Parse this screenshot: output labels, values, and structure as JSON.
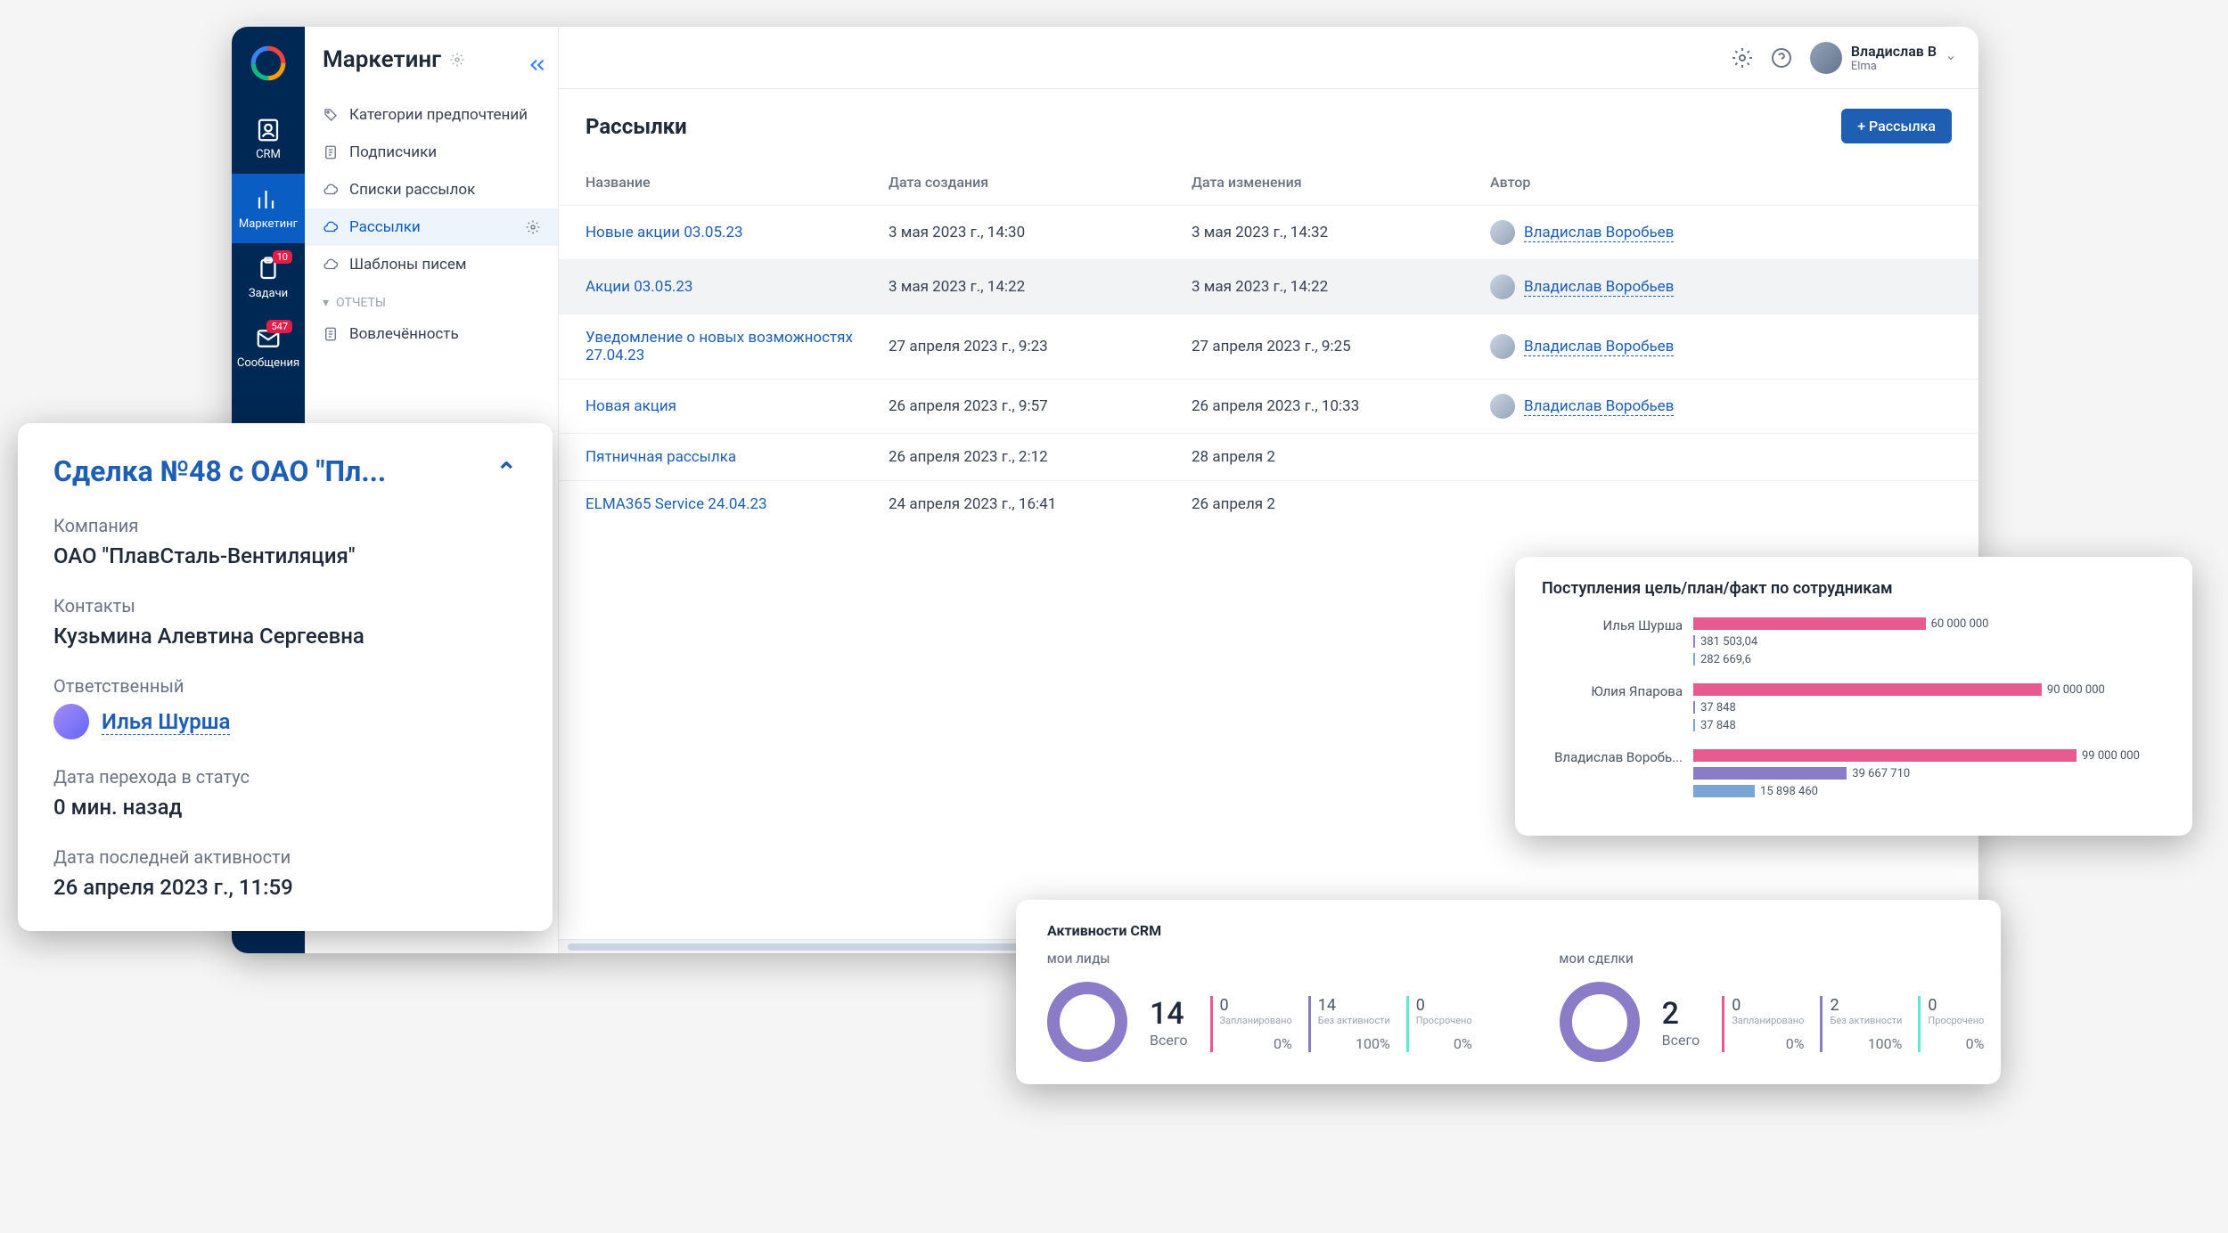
{
  "header": {
    "section_title": "Маркетинг",
    "user_name": "Владислав В",
    "user_org": "Elma"
  },
  "rail": [
    {
      "label": "CRM",
      "icon": "contact-icon",
      "active": false,
      "badge": null
    },
    {
      "label": "Маркетинг",
      "icon": "bars-icon",
      "active": true,
      "badge": null
    },
    {
      "label": "Задачи",
      "icon": "clipboard-icon",
      "active": false,
      "badge": "10"
    },
    {
      "label": "Сообщения",
      "icon": "mail-icon",
      "active": false,
      "badge": "547"
    }
  ],
  "sidebar": {
    "items": [
      {
        "label": "Категории предпочтений",
        "icon": "tag-icon",
        "active": false
      },
      {
        "label": "Подписчики",
        "icon": "doc-icon",
        "active": false
      },
      {
        "label": "Списки рассылок",
        "icon": "cloud-icon",
        "active": false
      },
      {
        "label": "Рассылки",
        "icon": "cloud-icon",
        "active": true
      },
      {
        "label": "Шаблоны писем",
        "icon": "cloud-icon",
        "active": false
      }
    ],
    "group_label": "ОТЧЕТЫ",
    "items2": [
      {
        "label": "Вовлечённость",
        "icon": "doc-icon",
        "active": false
      }
    ]
  },
  "page": {
    "title": "Рассылки",
    "add_button": "+ Рассылка"
  },
  "table": {
    "columns": [
      "Название",
      "Дата создания",
      "Дата изменения",
      "Автор"
    ],
    "rows": [
      {
        "name": "Новые акции 03.05.23",
        "created": "3 мая 2023 г., 14:30",
        "modified": "3 мая 2023 г., 14:32",
        "author": "Владислав Воробьев",
        "hover": false
      },
      {
        "name": "Акции 03.05.23",
        "created": "3 мая 2023 г., 14:22",
        "modified": "3 мая 2023 г., 14:22",
        "author": "Владислав Воробьев",
        "hover": true
      },
      {
        "name": "Уведомление о новых возможностях 27.04.23",
        "created": "27 апреля 2023 г., 9:23",
        "modified": "27 апреля 2023 г., 9:25",
        "author": "Владислав Воробьев",
        "hover": false
      },
      {
        "name": "Новая акция",
        "created": "26 апреля 2023 г., 9:57",
        "modified": "26 апреля 2023 г., 10:33",
        "author": "Владислав Воробьев",
        "hover": false
      },
      {
        "name": "Пятничная рассылка",
        "created": "26 апреля 2023 г., 2:12",
        "modified": "28 апреля 2",
        "author": "",
        "hover": false
      },
      {
        "name": "ELMA365 Service 24.04.23",
        "created": "24 апреля 2023 г., 16:41",
        "modified": "26 апреля 2",
        "author": "",
        "hover": false
      }
    ]
  },
  "deal": {
    "title": "Сделка №48 с ОАО \"Пл...",
    "fields": {
      "company_label": "Компания",
      "company_value": "ОАО \"ПлавСталь-Вентиляция\"",
      "contacts_label": "Контакты",
      "contacts_value": "Кузьмина Алевтина Сергеевна",
      "owner_label": "Ответственный",
      "owner_value": "Илья Шурша",
      "status_label": "Дата перехода в статус",
      "status_value": "0 мин. назад",
      "activity_label": "Дата последней активности",
      "activity_value": "26 апреля 2023 г., 11:59"
    }
  },
  "chart_data": {
    "type": "bar",
    "title": "Поступления цель/план/факт по сотрудникам",
    "orientation": "horizontal",
    "x_max": 99000000,
    "categories": [
      "Илья Шурша",
      "Юлия Япарова",
      "Владислав Воробь..."
    ],
    "series": [
      {
        "name": "цель",
        "color": "#e65a8f",
        "values": [
          60000000,
          90000000,
          99000000
        ],
        "labels": [
          "60 000 000",
          "90 000 000",
          "99 000 000"
        ]
      },
      {
        "name": "план",
        "color": "#8b7cc8",
        "values": [
          381503.04,
          37848,
          39667710
        ],
        "labels": [
          "381 503,04",
          "37 848",
          "39 667 710"
        ]
      },
      {
        "name": "факт",
        "color": "#7aa5d6",
        "values": [
          282669.6,
          37848,
          15898460
        ],
        "labels": [
          "282 669,6",
          "37 848",
          "15 898 460"
        ]
      }
    ]
  },
  "activities": {
    "title": "Активности CRM",
    "sections": [
      {
        "subtitle": "МОИ ЛИДЫ",
        "total": "14",
        "total_label": "Всего",
        "metrics": [
          {
            "num": "0",
            "label": "Запланировано",
            "pct": "0%",
            "color": "pink"
          },
          {
            "num": "14",
            "label": "Без активности",
            "pct": "100%",
            "color": "purple"
          },
          {
            "num": "0",
            "label": "Просрочено",
            "pct": "0%",
            "color": "teal"
          }
        ]
      },
      {
        "subtitle": "МОИ СДЕЛКИ",
        "total": "2",
        "total_label": "Всего",
        "metrics": [
          {
            "num": "0",
            "label": "Запланировано",
            "pct": "0%",
            "color": "pink"
          },
          {
            "num": "2",
            "label": "Без активности",
            "pct": "100%",
            "color": "purple"
          },
          {
            "num": "0",
            "label": "Просрочено",
            "pct": "0%",
            "color": "teal"
          }
        ]
      }
    ]
  }
}
